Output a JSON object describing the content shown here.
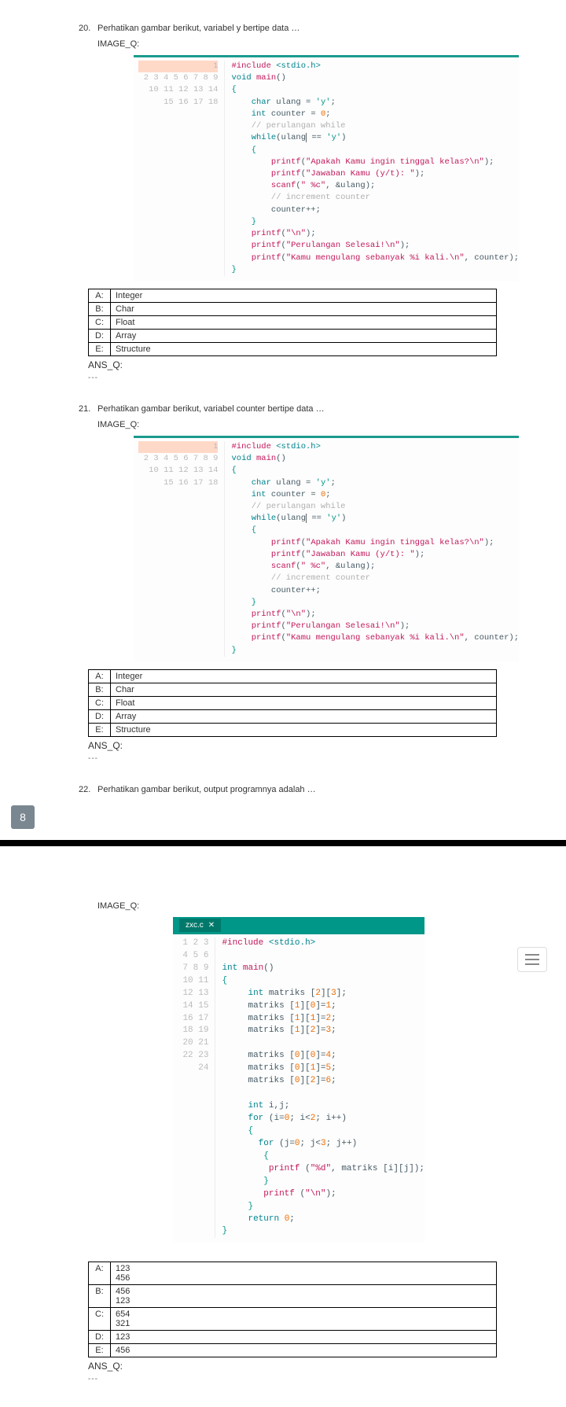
{
  "q20": {
    "number": "20.",
    "text": "Perhatikan gambar berikut, variabel y bertipe data …",
    "image_label": "IMAGE_Q:",
    "answers": {
      "A": "Integer",
      "B": "Char",
      "C": "Float",
      "D": "Array",
      "E": "Structure"
    },
    "ansq": "ANS_Q:",
    "dashes": "---"
  },
  "q21": {
    "number": "21.",
    "text": "Perhatikan gambar berikut, variabel counter bertipe data …",
    "image_label": "IMAGE_Q:",
    "answers": {
      "A": "Integer",
      "B": "Char",
      "C": "Float",
      "D": "Array",
      "E": "Structure"
    },
    "ansq": "ANS_Q:",
    "dashes": "---"
  },
  "q22": {
    "number": "22.",
    "text": "Perhatikan gambar berikut, output programnya adalah …",
    "image_label": "IMAGE_Q:",
    "tab": "zxc.c",
    "tab_close": "✕",
    "answers": {
      "A": "123\n456",
      "B": "456\n123",
      "C": "654\n321",
      "D": "123",
      "E": "456"
    },
    "ansq": "ANS_Q:",
    "dashes": "---"
  },
  "codeA_lines": [
    "1",
    "2",
    "3",
    "4",
    "5",
    "6",
    "7",
    "8",
    "9",
    "10",
    "11",
    "12",
    "13",
    "14",
    "15",
    "16",
    "17",
    "18"
  ],
  "codeB_lines": [
    "1",
    "2",
    "3",
    "4",
    "5",
    "6",
    "7",
    "8",
    "9",
    "10",
    "11",
    "12",
    "13",
    "14",
    "15",
    "16",
    "17",
    "18",
    "19",
    "20",
    "21",
    "22",
    "23",
    "24"
  ],
  "page_number": "8",
  "labels": {
    "A": "A:",
    "B": "B:",
    "C": "C:",
    "D": "D:",
    "E": "E:"
  }
}
